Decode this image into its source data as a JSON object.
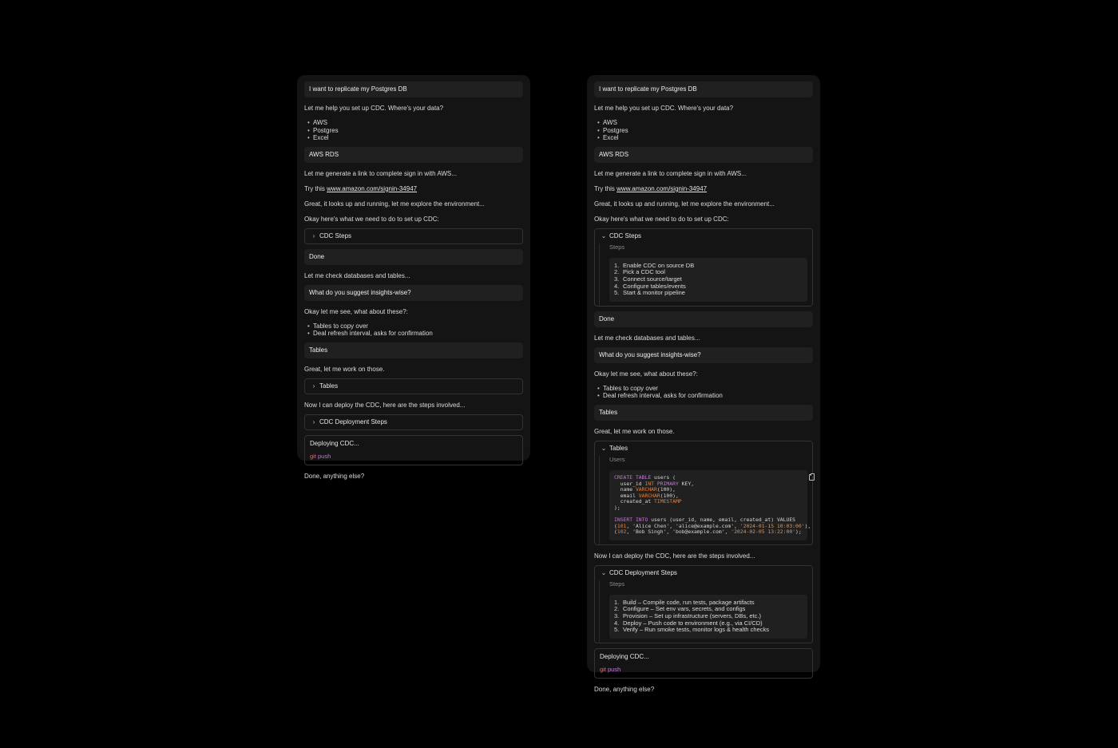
{
  "chat": {
    "user_1": "I want to replicate my Postgres DB",
    "ai_1": "Let me help you set up CDC. Where's your data?",
    "options": [
      "AWS",
      "Postgres",
      "Excel"
    ],
    "user_2": "AWS RDS",
    "ai_2": "Let me generate a link to complete sign in with AWS...",
    "ai_3_prefix": "Try this ",
    "ai_3_link": "www.amazon.com/signin-34947",
    "ai_4": "Great, it looks up and running, let me explore the environment...",
    "ai_5": "Okay here's what we need to do to set up CDC:",
    "cdc_steps": {
      "title": "CDC Steps",
      "sub_label": "Steps",
      "items": [
        "Enable CDC on source DB",
        "Pick a CDC tool",
        "Connect source/target",
        "Configure tables/events",
        "Start & monitor pipeline"
      ]
    },
    "user_3": "Done",
    "ai_6": "Let me check databases and tables...",
    "user_4": "What do you suggest insights-wise?",
    "ai_7": "Okay let me see, what about these?:",
    "suggestions": [
      "Tables to copy over",
      "Deal refresh interval, asks for confirmation"
    ],
    "user_5": "Tables",
    "ai_8": "Great, let me work on those.",
    "tables": {
      "title": "Tables",
      "sub_label": "Users"
    },
    "ai_9": "Now I can deploy the CDC, here are the steps involved...",
    "deploy_steps": {
      "title": "CDC Deployment Steps",
      "sub_label": "Steps",
      "items": [
        "Build – Compile code, run tests, package artifacts",
        "Configure – Set env vars, secrets, and configs",
        "Provision – Set up infrastructure (servers, DBs, etc.)",
        "Deploy – Push code to environment (e.g., via CI/CD)",
        "Verify – Run smoke tests, monitor logs & health checks"
      ]
    },
    "deploying": {
      "title": "Deploying CDC...",
      "cmd_git": "git",
      "cmd_push": "push"
    },
    "ai_10": "Done, anything else?"
  },
  "step_numbers": [
    "1.",
    "2.",
    "3.",
    "4.",
    "5."
  ],
  "sql": {
    "create": "CREATE",
    "table": "TABLE",
    "table_name": " users (",
    "col1_name": "  user_id ",
    "col1_type": "INT",
    "col1_sp": " ",
    "col1_pk": "PRIMARY",
    "col1_rest": " KEY,",
    "col2_name": "  name ",
    "col2_type": "VARCHAR",
    "col2_rest": "(100),",
    "col3_name": "  email ",
    "col3_type": "VARCHAR",
    "col3_rest": "(100),",
    "col4_name": "  created_at ",
    "col4_type": "TIMESTAMP",
    "close": ");",
    "insert": "INSERT",
    "into": "INTO",
    "insert_rest": " users (user_id, name, email, created_at) VALUES",
    "row1_open": "(",
    "row1_id": "101",
    "row1_mid": ", 'Alice Chen', 'alice@example.com', ",
    "row1_ts": "'2024-01-15 10:03:00'",
    "row1_end": "),",
    "row2_open": "(",
    "row2_id": "102",
    "row2_mid": ", 'Bob Singh', 'bob@example.com', ",
    "row2_ts": "'2024-02-05 13:22:00'",
    "row2_end": ");"
  },
  "colors": {
    "background": "#000000",
    "panel": "#141414",
    "bubble": "#202020",
    "keyword": "#c678dd",
    "type": "#e0823d",
    "git": "#e06c75"
  }
}
